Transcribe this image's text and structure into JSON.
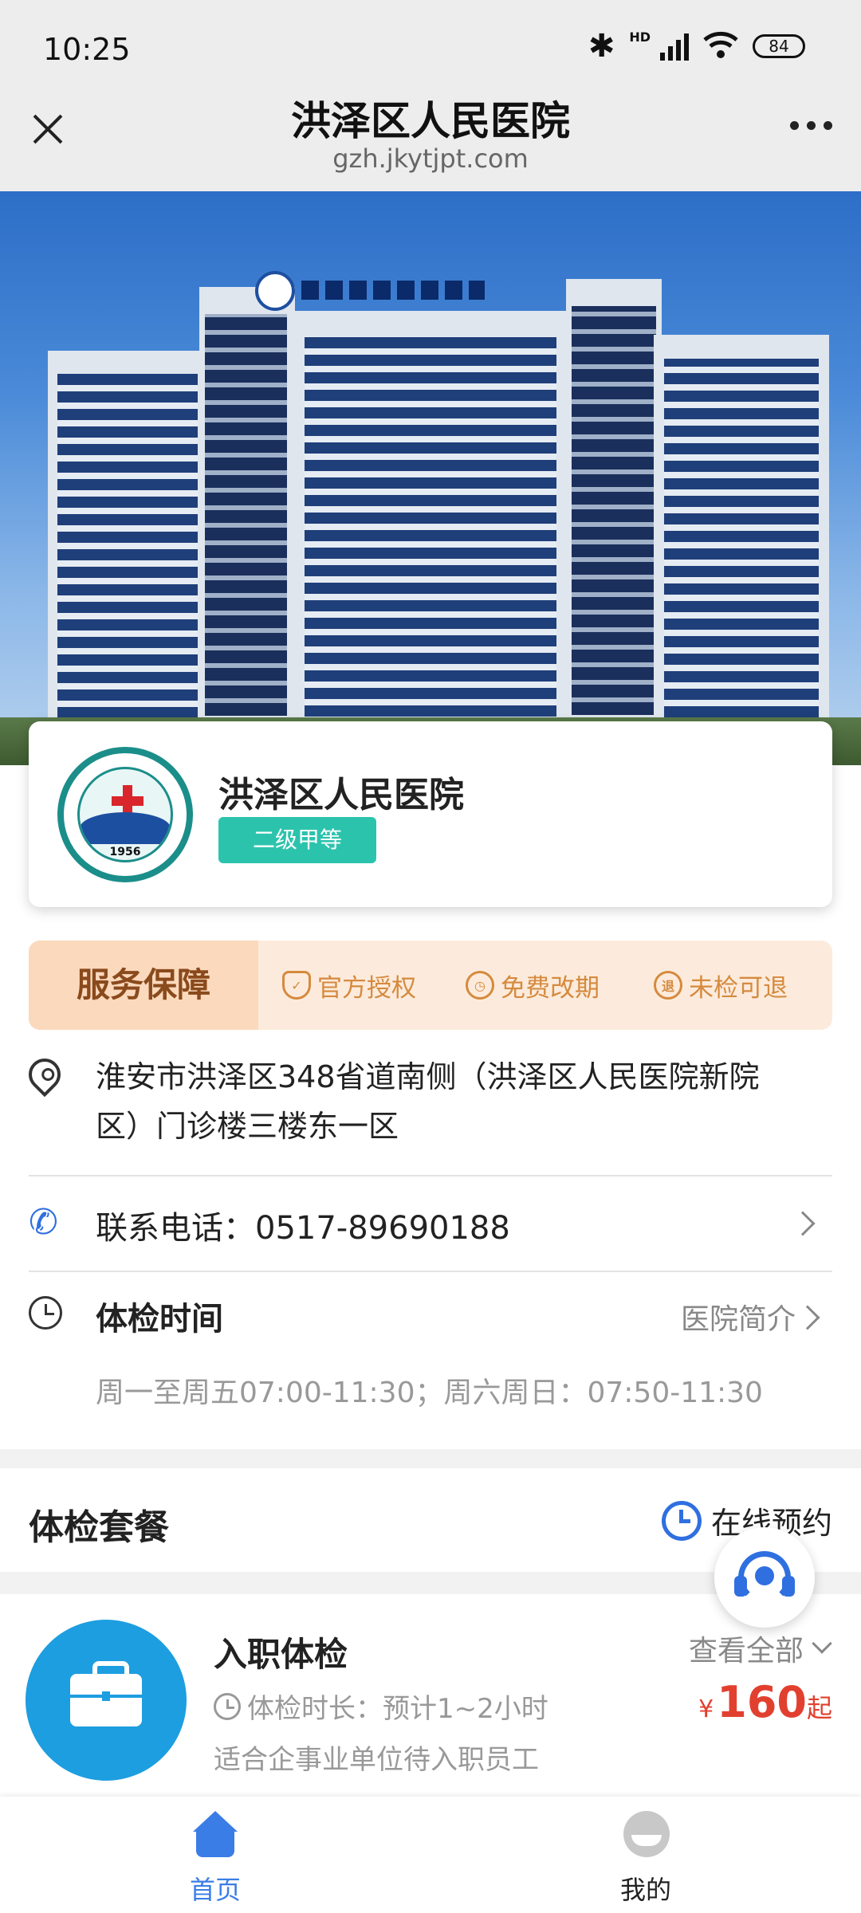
{
  "status_bar": {
    "time": "10:25",
    "hd": "HD",
    "battery": "84"
  },
  "title_bar": {
    "title": "洪泽区人民医院",
    "url": "gzh.jkytjpt.com"
  },
  "hospital": {
    "name": "洪泽区人民医院",
    "grade": "二级甲等",
    "logo_year": "1956"
  },
  "service": {
    "title": "服务保障",
    "items": [
      {
        "icon": "shield-check-icon",
        "label": "官方授权"
      },
      {
        "icon": "clock-icon",
        "label": "免费改期"
      },
      {
        "icon": "refund-icon",
        "icon_text": "退",
        "label": "未检可退"
      }
    ]
  },
  "address": {
    "line1": "淮安市洪泽区348省道南侧（洪泽区人民医院新院",
    "line2": "区）门诊楼三楼东一区"
  },
  "phone": {
    "label": "联系电话：0517-89690188"
  },
  "exam_time": {
    "label": "体检时间",
    "intro_link": "医院简介",
    "hours": "周一至周五07:00-11:30；周六周日：07:50-11:30"
  },
  "packages": {
    "title": "体检套餐",
    "book_online": "在线预约",
    "items": [
      {
        "name": "入职体检",
        "view_all": "查看全部",
        "duration": "体检时长：预计1~2小时",
        "desc": "适合企事业单位待入职员工",
        "currency": "¥",
        "price": "160",
        "price_suffix": "起"
      }
    ]
  },
  "tabbar": {
    "home": "首页",
    "mine": "我的"
  },
  "colors": {
    "accent_blue": "#3b7de6",
    "grade_teal": "#2cc3ad",
    "price_red": "#e2402f",
    "service_orange": "#d58a3e"
  }
}
